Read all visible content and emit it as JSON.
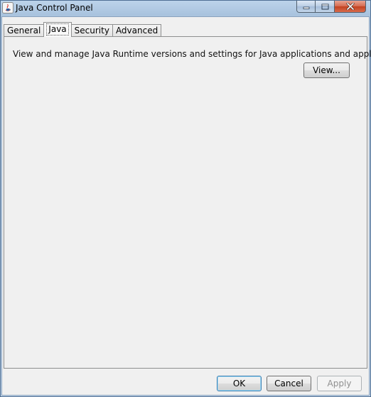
{
  "window": {
    "title": "Java Control Panel",
    "icon": "java-icon"
  },
  "caption_buttons": {
    "minimize_icon": "minimize-icon",
    "maximize_icon": "maximize-icon",
    "close_icon": "close-icon",
    "close_color": "#c7402a"
  },
  "tabs": [
    {
      "label": "General",
      "selected": false
    },
    {
      "label": "Java",
      "selected": true
    },
    {
      "label": "Security",
      "selected": false
    },
    {
      "label": "Advanced",
      "selected": false
    }
  ],
  "java_tab": {
    "description": "View and manage Java Runtime versions and settings for Java applications and applets.",
    "view_button": "View..."
  },
  "footer": {
    "ok": "OK",
    "cancel": "Cancel",
    "apply": "Apply",
    "apply_enabled": false
  }
}
